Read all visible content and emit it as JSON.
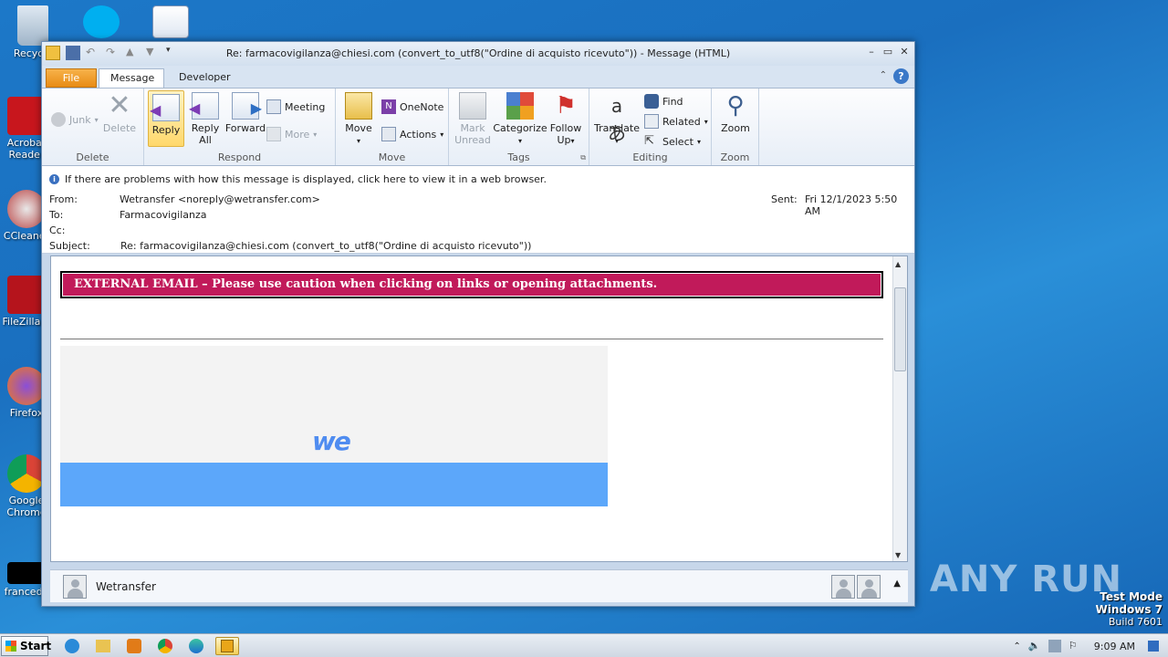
{
  "desktop": {
    "icons": [
      "Recycle",
      "Acrobat Reader",
      "CCleaner",
      "FileZilla C",
      "Firefox",
      "Google Chrome",
      "francede"
    ]
  },
  "window": {
    "title": "Re: farmacovigilanza@chiesi.com (convert_to_utf8(\"Ordine di acquisto ricevuto\")) - Message (HTML)"
  },
  "tabs": {
    "file": "File",
    "message": "Message",
    "developer": "Developer"
  },
  "ribbon": {
    "delete_group": {
      "name": "Delete",
      "junk": "Junk",
      "delete": "Delete"
    },
    "respond_group": {
      "name": "Respond",
      "reply": "Reply",
      "reply_all_1": "Reply",
      "reply_all_2": "All",
      "forward": "Forward",
      "meeting": "Meeting",
      "more": "More"
    },
    "move_group": {
      "name": "Move",
      "move": "Move",
      "onenote": "OneNote",
      "actions": "Actions"
    },
    "tags_group": {
      "name": "Tags",
      "mark_1": "Mark",
      "mark_2": "Unread",
      "categorize": "Categorize",
      "follow_1": "Follow",
      "follow_2": "Up"
    },
    "editing_group": {
      "name": "Editing",
      "translate": "Translate",
      "find": "Find",
      "related": "Related",
      "select": "Select"
    },
    "zoom_group": {
      "name": "Zoom",
      "zoom": "Zoom"
    }
  },
  "message": {
    "info": "If there are problems with how this message is displayed, click here to view it in a web browser.",
    "from_label": "From:",
    "from": "Wetransfer <noreply@wetransfer.com>",
    "to_label": "To:",
    "to": "Farmacovigilanza",
    "cc_label": "Cc:",
    "subject_label": "Subject:",
    "subject": "Re: farmacovigilanza@chiesi.com (convert_to_utf8(\"Ordine di acquisto ricevuto\"))",
    "sent_label": "Sent:",
    "sent": "Fri 12/1/2023 5:50 AM"
  },
  "body": {
    "banner": "EXTERNAL EMAIL – Please use caution when clicking on links or opening attachments.",
    "logo_text": "we"
  },
  "footer": {
    "sender": "Wetransfer"
  },
  "watermark": {
    "brand": "ANY RUN",
    "mode": "Test Mode",
    "os": "Windows 7",
    "build": "Build 7601"
  },
  "taskbar": {
    "start": "Start",
    "time": "9:09 AM"
  }
}
